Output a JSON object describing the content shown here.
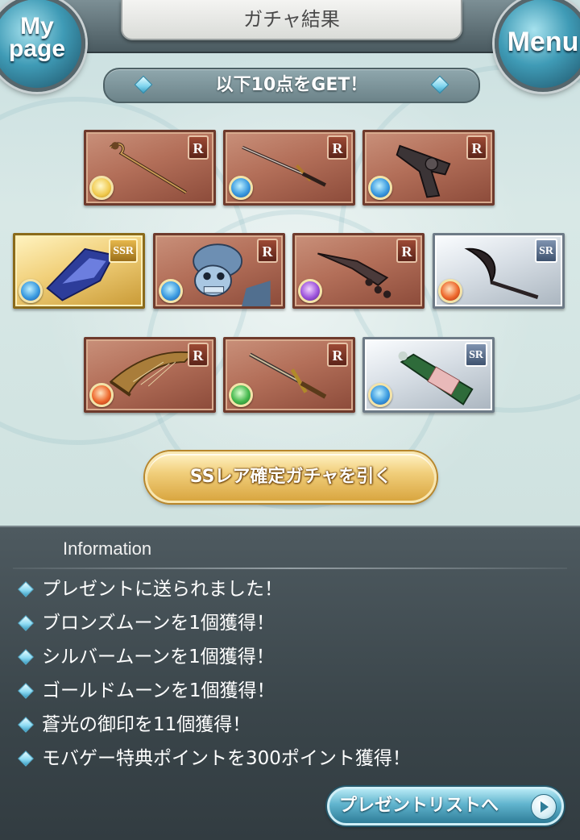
{
  "header": {
    "title": "ガチャ結果",
    "mypage_line1": "My",
    "mypage_line2": "page",
    "menu_label": "Menu"
  },
  "banner": {
    "text": "以下10点をGET！"
  },
  "items": [
    {
      "name": "staff",
      "rarity": "R",
      "element": "light"
    },
    {
      "name": "dagger",
      "rarity": "R",
      "element": "water"
    },
    {
      "name": "revolver",
      "rarity": "R",
      "element": "water"
    },
    {
      "name": "crystal",
      "rarity": "SSR",
      "element": "water"
    },
    {
      "name": "skeleton",
      "rarity": "R",
      "element": "water"
    },
    {
      "name": "knuckle-blade",
      "rarity": "R",
      "element": "dark"
    },
    {
      "name": "scythe",
      "rarity": "SR",
      "element": "fire"
    },
    {
      "name": "harp",
      "rarity": "R",
      "element": "fire"
    },
    {
      "name": "sword",
      "rarity": "R",
      "element": "wind"
    },
    {
      "name": "bottle",
      "rarity": "SR",
      "element": "water"
    }
  ],
  "draw_button": {
    "label": "SSレア確定ガチャを引く"
  },
  "info": {
    "title": "Information",
    "lines": [
      "プレゼントに送られました！",
      "ブロンズムーンを1個獲得！",
      "シルバームーンを1個獲得！",
      "ゴールドムーンを1個獲得！",
      "蒼光の御印を11個獲得！",
      "モバゲー特典ポイントを300ポイント獲得！"
    ]
  },
  "present_button": {
    "label": "プレゼントリストへ"
  },
  "colors": {
    "panel": "#3a454a",
    "accent_blue": "#5fb3cd",
    "gold": "#f1cf7c",
    "card_r": "#b36f59"
  }
}
